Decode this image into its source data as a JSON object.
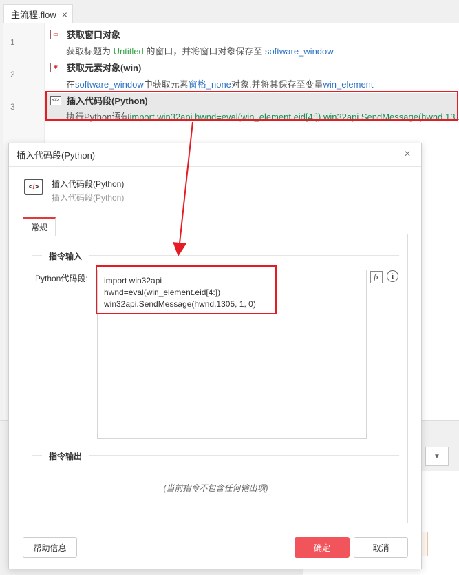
{
  "editor_tab": {
    "label": "主流程.flow",
    "close": "×"
  },
  "steps": [
    {
      "line": "1",
      "title": "获取窗口对象",
      "desc_parts": [
        "获取标题为 ",
        "Untitled",
        " 的窗口，并将窗口对象保存至 ",
        "software_window"
      ]
    },
    {
      "line": "2",
      "title": "获取元素对象(win)",
      "desc_parts": [
        "在",
        "software_window",
        "中获取元素",
        "窗格_none",
        "对象,并将其保存至变量",
        "win_element"
      ]
    },
    {
      "line": "3",
      "title": "插入代码段(Python)",
      "desc_parts": [
        "执行Python语句",
        "import win32api hwnd=eval(win_element.eid[4:]) win32api.SendMessage(hwnd,13..."
      ]
    }
  ],
  "dialog": {
    "title": "插入代码段(Python)",
    "close": "×",
    "cmd_name": "插入代码段(Python)",
    "cmd_sub": "插入代码段(Python)",
    "tab_general": "常规",
    "section_input": "指令输入",
    "field_label": "Python代码段:",
    "code": "import win32api\nhwnd=eval(win_element.eid[4:])\nwin32api.SendMessage(hwnd,1305, 1, 0)",
    "fx_label": "fx",
    "info_label": "i",
    "section_output": "指令输出",
    "no_output": "(当前指令不包含任何输出项)",
    "help_button": "帮助信息",
    "ok_button": "确定",
    "cancel_button": "取消"
  },
  "colors": {
    "accent_red": "#e51c23",
    "ok_button": "#f2545b",
    "var_blue": "#2d73c4",
    "string_green": "#34a34a"
  }
}
